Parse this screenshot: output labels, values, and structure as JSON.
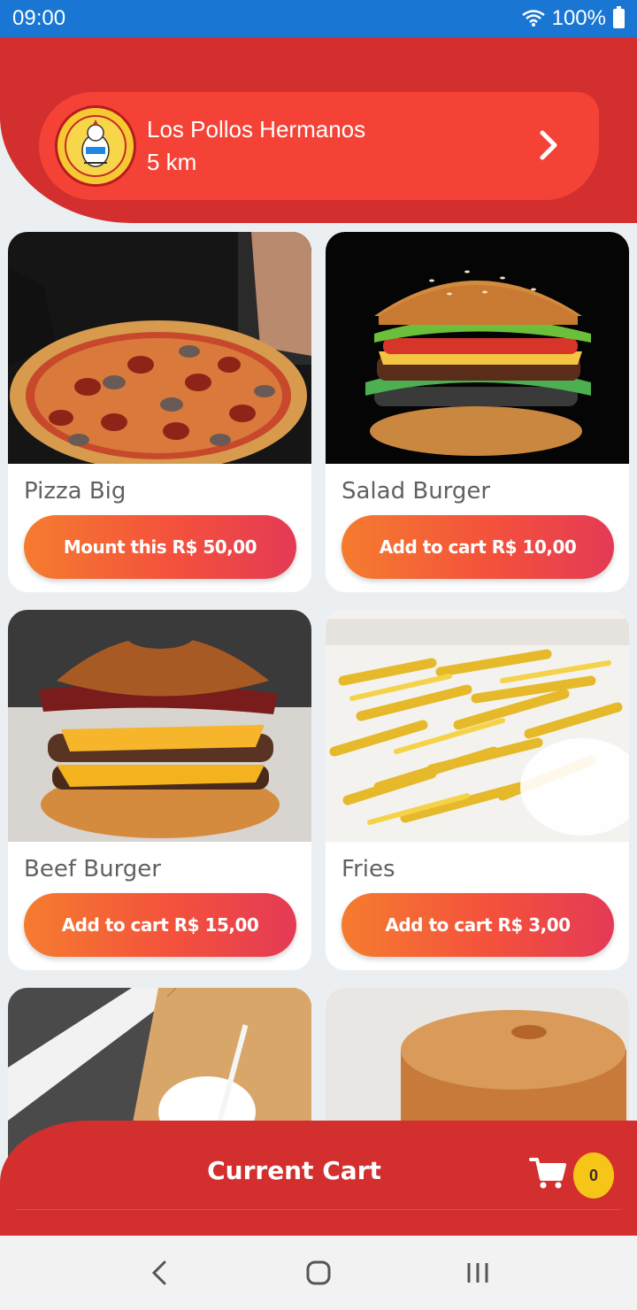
{
  "status_bar": {
    "time": "09:00",
    "battery": "100%"
  },
  "store": {
    "name": "Los Pollos Hermanos",
    "distance": "5 km",
    "logo_icon": "chicken-logo-icon"
  },
  "products": [
    {
      "name": "Pizza Big",
      "button": "Mount this R$ 50,00",
      "photo": "pizza-photo"
    },
    {
      "name": "Salad Burger",
      "button": "Add to cart R$ 10,00",
      "photo": "salad-burger-photo"
    },
    {
      "name": "Beef Burger",
      "button": "Add to cart R$ 15,00",
      "photo": "beef-burger-photo"
    },
    {
      "name": "Fries",
      "button": "Add to cart R$ 3,00",
      "photo": "fries-photo"
    },
    {
      "name": "",
      "button": "",
      "photo": "drink-photo"
    },
    {
      "name": "",
      "button": "",
      "photo": "dessert-photo"
    }
  ],
  "cart": {
    "title": "Current Cart",
    "count": "0",
    "icon": "cart-icon"
  },
  "colors": {
    "primary": "#d32f2f",
    "accent": "#f44336",
    "status_bar": "#1976d2",
    "button_gradient_start": "#f57c2f",
    "button_gradient_end": "#e43a55",
    "badge": "#f5c518"
  },
  "nav": {
    "back_icon": "back-icon",
    "home_icon": "home-icon",
    "recents_icon": "recents-icon"
  }
}
